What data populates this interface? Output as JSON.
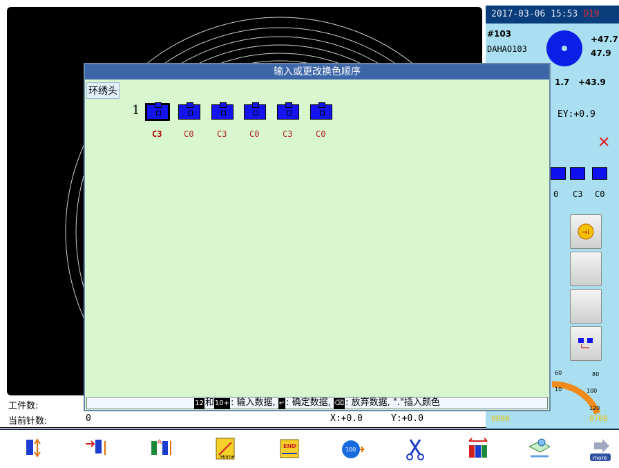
{
  "right_panel": {
    "datetime": "2017-03-06 15:53",
    "datetime_suffix": "D19",
    "design_number": "#103",
    "design_name": "DAHAO103",
    "dim_top": "+47.7",
    "dim_mid": "47.9",
    "dim_left": "1.7",
    "dim_right": "+43.9",
    "ey_readout": "EY:+0.9",
    "preview_labels": [
      "0",
      "C3",
      "C0"
    ],
    "gauge_labels": [
      "60",
      "80",
      "100",
      "120",
      "10"
    ],
    "counter_left": "0000",
    "counter_right": "0700"
  },
  "dialog": {
    "title": "输入或更改换色顺序",
    "tab_label": "环绣头",
    "row_number": "1",
    "colors": [
      "C3",
      "C0",
      "C3",
      "C0",
      "C3",
      "C0"
    ],
    "status": {
      "key1": "12",
      "and": "和",
      "key2": "10+",
      "text1": ": 输入数据, ",
      "text2": ": 确定数据, ",
      "text3": ": 放弃数据, \".\"插入颜色"
    }
  },
  "bottom": {
    "workpiece_label": "工件数:",
    "stitch_label": "当前针数:",
    "stitch_value": "0",
    "x_readout": "X:+0.0",
    "y_readout": "Y:+0.0"
  },
  "toolbar": {
    "more_label": "more",
    "home_label": "Home",
    "end_label": "END",
    "speed_label": "100"
  },
  "colors": {
    "dialog_bg": "#d9f7cf",
    "title_bar": "#3c66a8",
    "color_box": "#1414f0",
    "panel_bg": "#a9dff0"
  }
}
